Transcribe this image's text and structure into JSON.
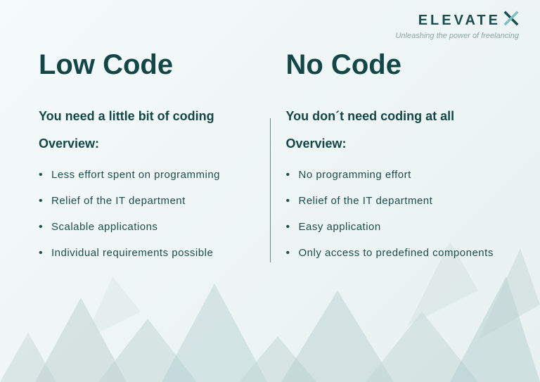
{
  "brand": {
    "name": "ELEVATE",
    "tagline": "Unleashing the power of freelancing"
  },
  "columns": [
    {
      "title": "Low Code",
      "subtitle": "You need a little bit of coding",
      "overview_label": "Overview:",
      "items": [
        "Less effort spent on programming",
        "Relief of the IT department",
        "Scalable applications",
        "Individual requirements possible"
      ]
    },
    {
      "title": "No Code",
      "subtitle": "You don´t need coding at all",
      "overview_label": "Overview:",
      "items": [
        "No programming effort",
        "Relief of the IT department",
        "Easy application",
        "Only access to predefined components"
      ]
    }
  ]
}
